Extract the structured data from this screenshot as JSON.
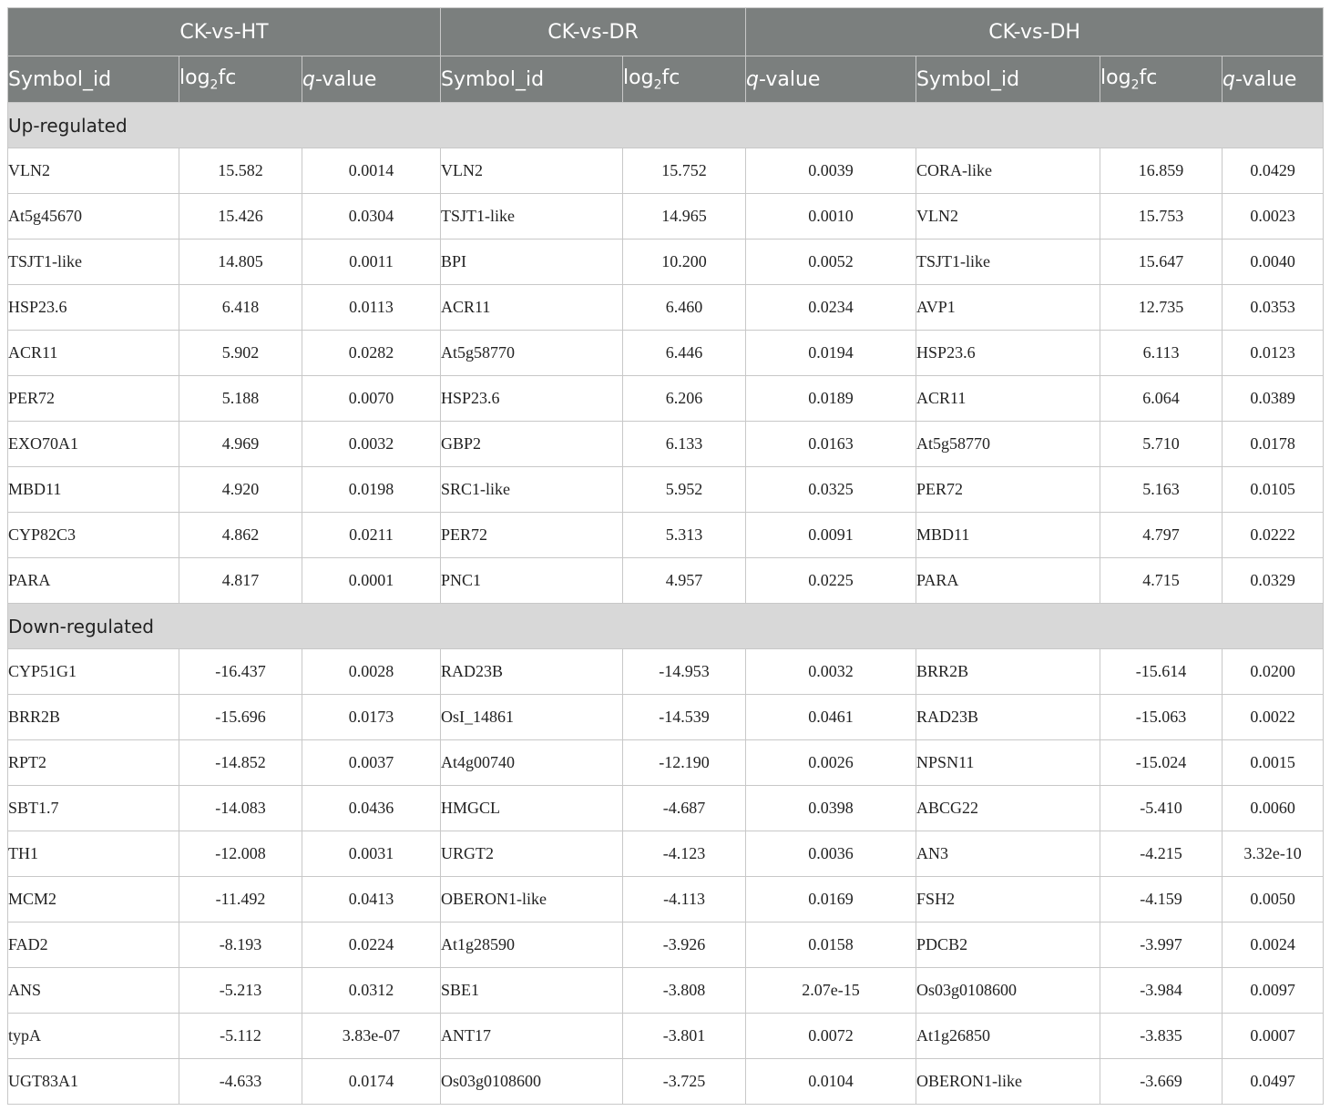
{
  "groups": [
    "CK-vs-HT",
    "CK-vs-DR",
    "CK-vs-DH"
  ],
  "headers": {
    "symbol": "Symbol_id",
    "logfc_prefix": "log",
    "logfc_sub": "2",
    "logfc_suffix": "fc",
    "q_italic": "q",
    "q_suffix": "-value"
  },
  "sections": [
    {
      "label": "Up-regulated",
      "rows": [
        [
          [
            "VLN2",
            "15.582",
            "0.0014"
          ],
          [
            "VLN2",
            "15.752",
            "0.0039"
          ],
          [
            "CORA-like",
            "16.859",
            "0.0429"
          ]
        ],
        [
          [
            "At5g45670",
            "15.426",
            "0.0304"
          ],
          [
            "TSJT1-like",
            "14.965",
            "0.0010"
          ],
          [
            "VLN2",
            "15.753",
            "0.0023"
          ]
        ],
        [
          [
            "TSJT1-like",
            "14.805",
            "0.0011"
          ],
          [
            "BPI",
            "10.200",
            "0.0052"
          ],
          [
            "TSJT1-like",
            "15.647",
            "0.0040"
          ]
        ],
        [
          [
            "HSP23.6",
            "6.418",
            "0.0113"
          ],
          [
            "ACR11",
            "6.460",
            "0.0234"
          ],
          [
            "AVP1",
            "12.735",
            "0.0353"
          ]
        ],
        [
          [
            "ACR11",
            "5.902",
            "0.0282"
          ],
          [
            "At5g58770",
            "6.446",
            "0.0194"
          ],
          [
            "HSP23.6",
            "6.113",
            "0.0123"
          ]
        ],
        [
          [
            "PER72",
            "5.188",
            "0.0070"
          ],
          [
            "HSP23.6",
            "6.206",
            "0.0189"
          ],
          [
            "ACR11",
            "6.064",
            "0.0389"
          ]
        ],
        [
          [
            "EXO70A1",
            "4.969",
            "0.0032"
          ],
          [
            "GBP2",
            "6.133",
            "0.0163"
          ],
          [
            "At5g58770",
            "5.710",
            "0.0178"
          ]
        ],
        [
          [
            "MBD11",
            "4.920",
            "0.0198"
          ],
          [
            "SRC1-like",
            "5.952",
            "0.0325"
          ],
          [
            "PER72",
            "5.163",
            "0.0105"
          ]
        ],
        [
          [
            "CYP82C3",
            "4.862",
            "0.0211"
          ],
          [
            "PER72",
            "5.313",
            "0.0091"
          ],
          [
            "MBD11",
            "4.797",
            "0.0222"
          ]
        ],
        [
          [
            "PARA",
            "4.817",
            "0.0001"
          ],
          [
            "PNC1",
            "4.957",
            "0.0225"
          ],
          [
            "PARA",
            "4.715",
            "0.0329"
          ]
        ]
      ]
    },
    {
      "label": "Down-regulated",
      "rows": [
        [
          [
            "CYP51G1",
            "-16.437",
            "0.0028"
          ],
          [
            "RAD23B",
            "-14.953",
            "0.0032"
          ],
          [
            "BRR2B",
            "-15.614",
            "0.0200"
          ]
        ],
        [
          [
            "BRR2B",
            "-15.696",
            "0.0173"
          ],
          [
            "OsI_14861",
            "-14.539",
            "0.0461"
          ],
          [
            "RAD23B",
            "-15.063",
            "0.0022"
          ]
        ],
        [
          [
            "RPT2",
            "-14.852",
            "0.0037"
          ],
          [
            "At4g00740",
            "-12.190",
            "0.0026"
          ],
          [
            "NPSN11",
            "-15.024",
            "0.0015"
          ]
        ],
        [
          [
            "SBT1.7",
            "-14.083",
            "0.0436"
          ],
          [
            "HMGCL",
            "-4.687",
            "0.0398"
          ],
          [
            "ABCG22",
            "-5.410",
            "0.0060"
          ]
        ],
        [
          [
            "TH1",
            "-12.008",
            "0.0031"
          ],
          [
            "URGT2",
            "-4.123",
            "0.0036"
          ],
          [
            "AN3",
            "-4.215",
            "3.32e-10"
          ]
        ],
        [
          [
            "MCM2",
            "-11.492",
            "0.0413"
          ],
          [
            "OBERON1-like",
            "-4.113",
            "0.0169"
          ],
          [
            "FSH2",
            "-4.159",
            "0.0050"
          ]
        ],
        [
          [
            "FAD2",
            "-8.193",
            "0.0224"
          ],
          [
            "At1g28590",
            "-3.926",
            "0.0158"
          ],
          [
            "PDCB2",
            "-3.997",
            "0.0024"
          ]
        ],
        [
          [
            "ANS",
            "-5.213",
            "0.0312"
          ],
          [
            "SBE1",
            "-3.808",
            "2.07e-15"
          ],
          [
            "Os03g0108600",
            "-3.984",
            "0.0097"
          ]
        ],
        [
          [
            "typA",
            "-5.112",
            "3.83e-07"
          ],
          [
            "ANT17",
            "-3.801",
            "0.0072"
          ],
          [
            "At1g26850",
            "-3.835",
            "0.0007"
          ]
        ],
        [
          [
            "UGT83A1",
            "-4.633",
            "0.0174"
          ],
          [
            "Os03g0108600",
            "-3.725",
            "0.0104"
          ],
          [
            "OBERON1-like",
            "-3.669",
            "0.0497"
          ]
        ]
      ]
    }
  ]
}
